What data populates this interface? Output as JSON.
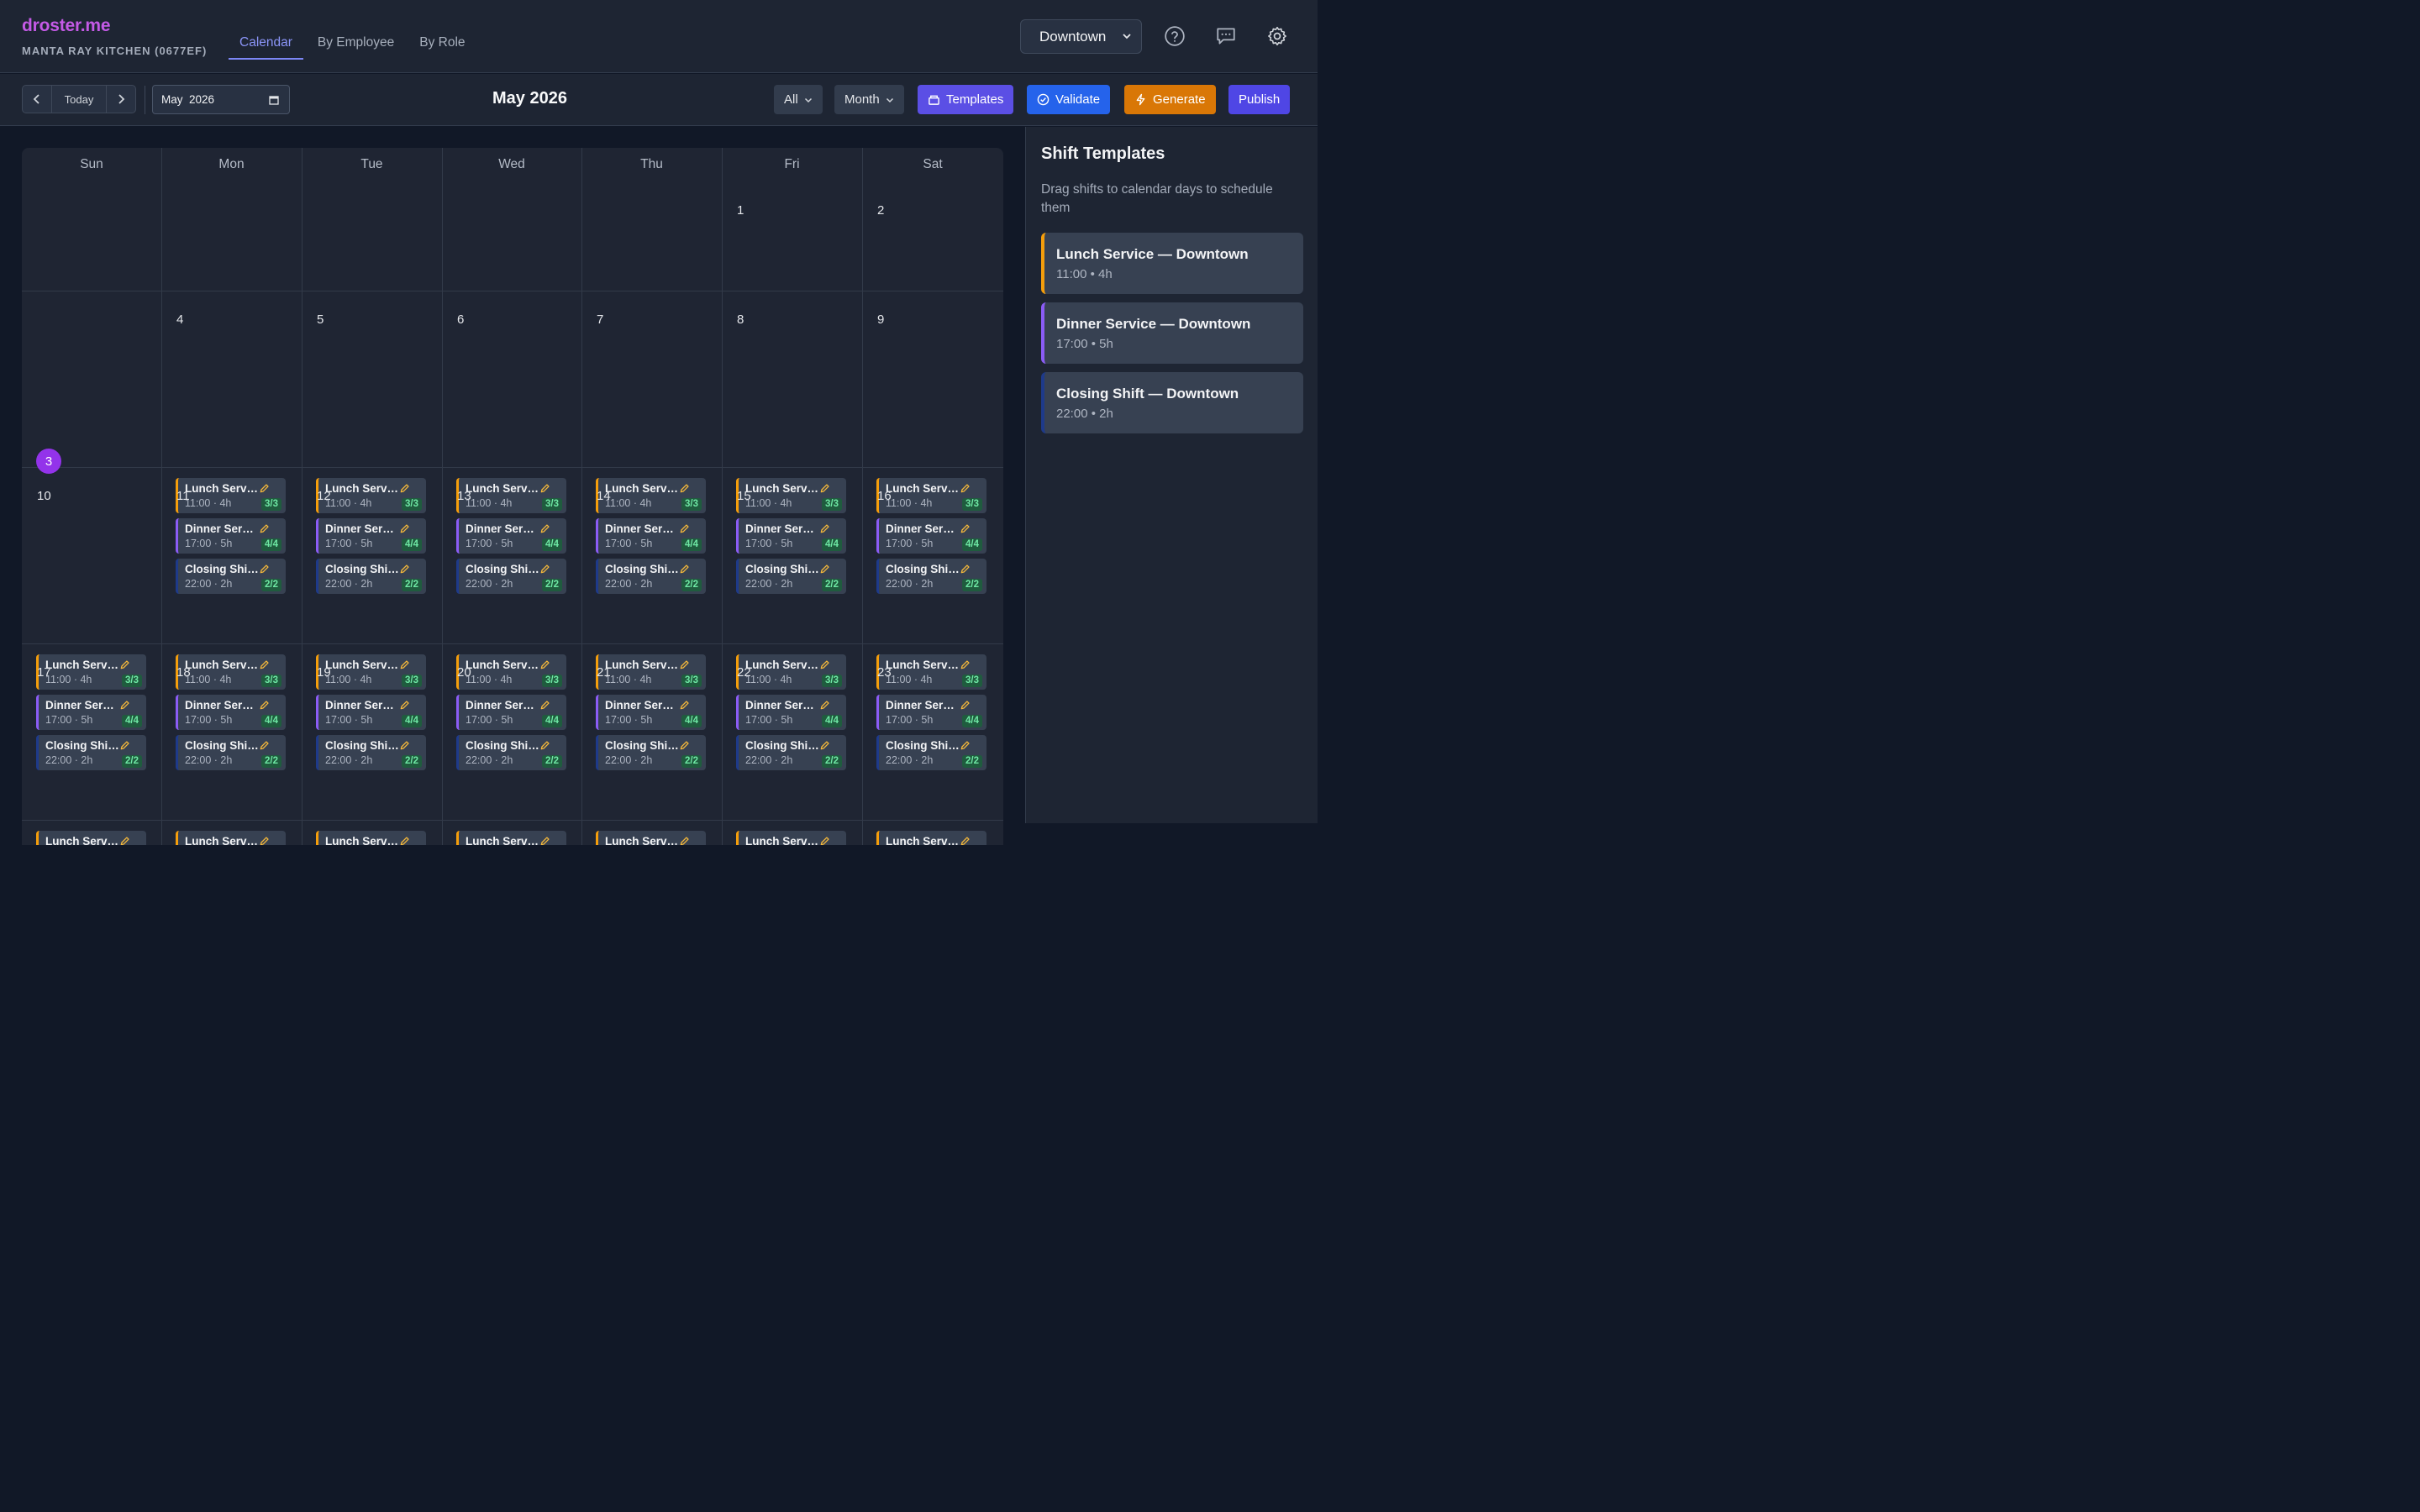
{
  "app": {
    "brand": "droster.me",
    "organization": "MANTA RAY KITCHEN (0677EF)",
    "tabs": [
      "Calendar",
      "By Employee",
      "By Role"
    ],
    "active_tab": "Calendar",
    "location": "Downtown"
  },
  "toolbar": {
    "today_label": "Today",
    "month_value": "May  2026",
    "title": "May 2026",
    "filter_label": "All",
    "view_label": "Month",
    "templates_label": "Templates",
    "validate_label": "Validate",
    "generate_label": "Generate",
    "publish_label": "Publish",
    "colors": {
      "templates": "#5b4fe5",
      "validate": "#2563eb",
      "generate": "#d97706",
      "publish": "#4f46e5"
    }
  },
  "calendar": {
    "weekdays": [
      "Sun",
      "Mon",
      "Tue",
      "Wed",
      "Thu",
      "Fri",
      "Sat"
    ],
    "today": 3,
    "weeks": [
      [
        null,
        null,
        null,
        null,
        null,
        1,
        2
      ],
      [
        3,
        4,
        5,
        6,
        7,
        8,
        9
      ],
      [
        10,
        11,
        12,
        13,
        14,
        15,
        16
      ],
      [
        17,
        18,
        19,
        20,
        21,
        22,
        23
      ]
    ],
    "unscheduled_days": [
      1,
      2,
      3
    ],
    "shifts": [
      {
        "type": "lunch",
        "name": "Lunch Service — Downtown",
        "short_name": "Lunch Serv...",
        "time": "11:00 · 4h",
        "filled": "3/3",
        "color": "#f59e0b"
      },
      {
        "type": "dinner",
        "name": "Dinner Service — Downtown",
        "short_name": "Dinner Ser...",
        "time": "17:00 · 5h",
        "filled": "4/4",
        "color": "#8b5cf6"
      },
      {
        "type": "closing",
        "name": "Closing Shift — Downtown",
        "short_name": "Closing Shi...",
        "time": "22:00 · 2h",
        "filled": "2/2",
        "color": "#1e3a8a"
      }
    ]
  },
  "panel": {
    "title": "Shift Templates",
    "description": "Drag shifts to calendar days to schedule them",
    "templates": [
      {
        "type": "lunch",
        "name": "Lunch Service — Downtown",
        "time": "11:00 • 4h"
      },
      {
        "type": "dinner",
        "name": "Dinner Service — Downtown",
        "time": "17:00 • 5h"
      },
      {
        "type": "closing",
        "name": "Closing Shift — Downtown",
        "time": "22:00 • 2h"
      }
    ]
  }
}
